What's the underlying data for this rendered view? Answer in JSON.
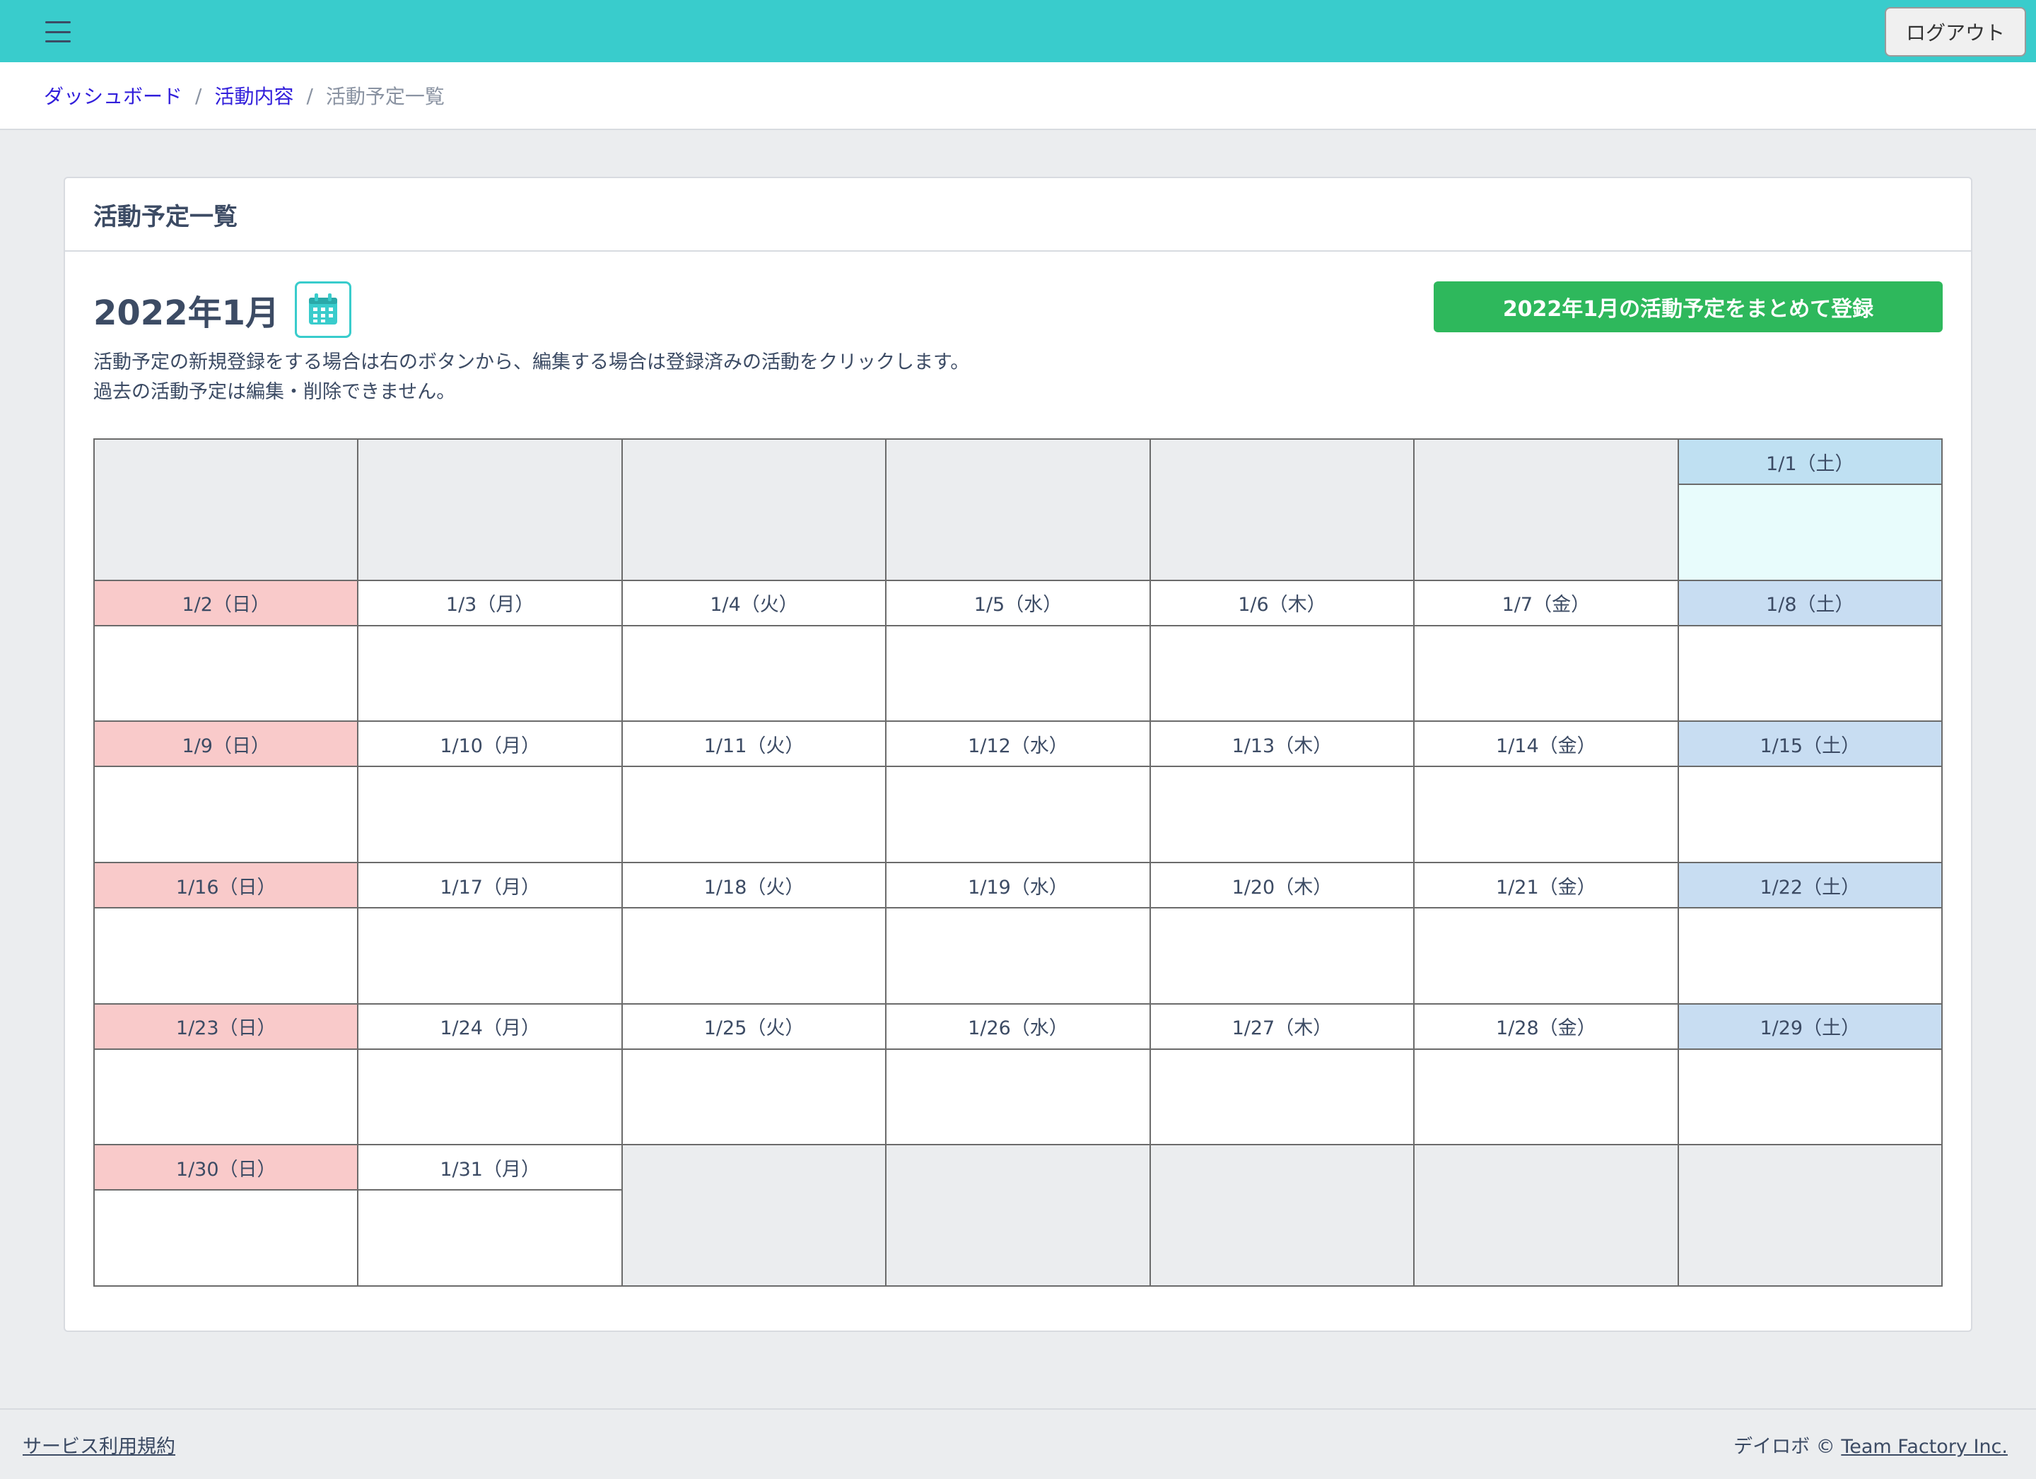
{
  "header": {
    "logout_label": "ログアウト"
  },
  "breadcrumb": {
    "items": [
      "ダッシュボード",
      "活動内容"
    ],
    "current": "活動予定一覧",
    "separator": "/"
  },
  "card": {
    "title": "活動予定一覧",
    "month_title": "2022年1月",
    "bulk_register_label": "2022年1月の活動予定をまとめて登録",
    "description_line1": "活動予定の新規登録をする場合は右のボタンから、編集する場合は登録済みの活動をクリックします。",
    "description_line2": "過去の活動予定は編集・削除できません。"
  },
  "calendar": {
    "leading_empty": 6,
    "days": [
      {
        "label": "1/1（土）",
        "type": "sat"
      },
      {
        "label": "1/2（日）",
        "type": "sun"
      },
      {
        "label": "1/3（月）",
        "type": "weekday"
      },
      {
        "label": "1/4（火）",
        "type": "weekday"
      },
      {
        "label": "1/5（水）",
        "type": "weekday"
      },
      {
        "label": "1/6（木）",
        "type": "weekday"
      },
      {
        "label": "1/7（金）",
        "type": "weekday"
      },
      {
        "label": "1/8（土）",
        "type": "sat"
      },
      {
        "label": "1/9（日）",
        "type": "sun"
      },
      {
        "label": "1/10（月）",
        "type": "weekday"
      },
      {
        "label": "1/11（火）",
        "type": "weekday"
      },
      {
        "label": "1/12（水）",
        "type": "weekday"
      },
      {
        "label": "1/13（木）",
        "type": "weekday"
      },
      {
        "label": "1/14（金）",
        "type": "weekday"
      },
      {
        "label": "1/15（土）",
        "type": "sat"
      },
      {
        "label": "1/16（日）",
        "type": "sun"
      },
      {
        "label": "1/17（月）",
        "type": "weekday"
      },
      {
        "label": "1/18（火）",
        "type": "weekday"
      },
      {
        "label": "1/19（水）",
        "type": "weekday"
      },
      {
        "label": "1/20（木）",
        "type": "weekday"
      },
      {
        "label": "1/21（金）",
        "type": "weekday"
      },
      {
        "label": "1/22（土）",
        "type": "sat"
      },
      {
        "label": "1/23（日）",
        "type": "sun"
      },
      {
        "label": "1/24（月）",
        "type": "weekday"
      },
      {
        "label": "1/25（火）",
        "type": "weekday"
      },
      {
        "label": "1/26（水）",
        "type": "weekday"
      },
      {
        "label": "1/27（木）",
        "type": "weekday"
      },
      {
        "label": "1/28（金）",
        "type": "weekday"
      },
      {
        "label": "1/29（土）",
        "type": "sat"
      },
      {
        "label": "1/30（日）",
        "type": "sun"
      },
      {
        "label": "1/31（月）",
        "type": "weekday"
      }
    ],
    "trailing_empty": 5
  },
  "footer": {
    "terms_label": "サービス利用規約",
    "brand_prefix": "デイロボ ©",
    "company_label": "Team Factory Inc."
  },
  "colors": {
    "topbar": "#39cccc",
    "primary_button": "#2eb85c",
    "sunday": "#f9caca",
    "saturday": "#c8ddf2",
    "link": "#321fdb"
  },
  "icons": {
    "menu": "hamburger-icon",
    "calendar": "calendar-icon"
  }
}
